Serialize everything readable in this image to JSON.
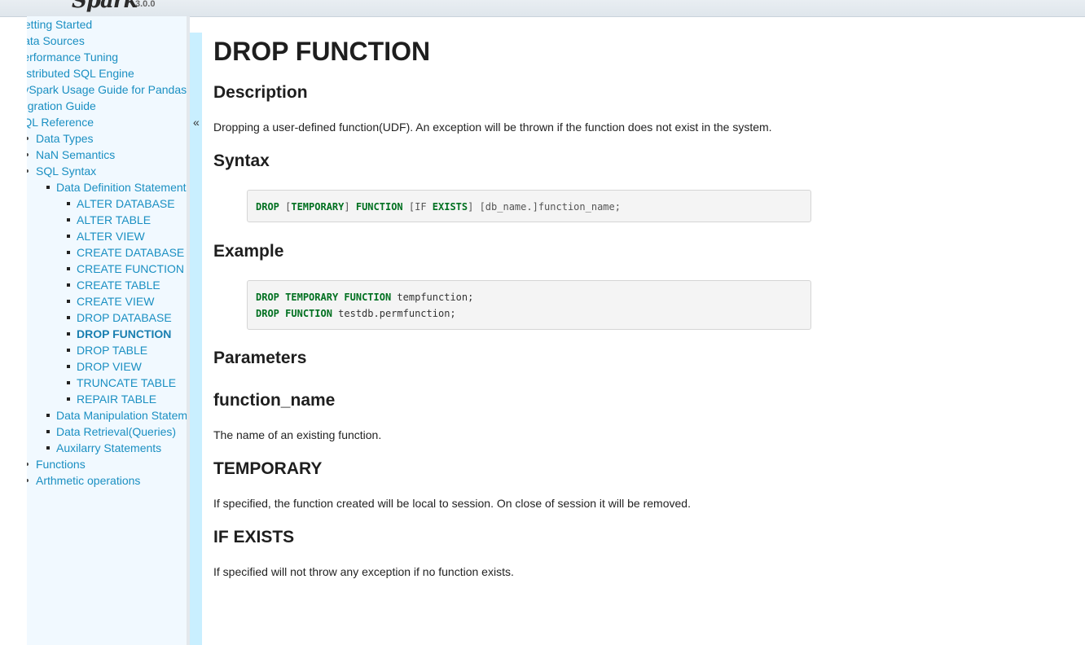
{
  "header": {
    "logo_text": "Spark",
    "version": "3.0.0"
  },
  "sidebar": {
    "collapse_glyph": "«",
    "items": [
      {
        "label": "Getting Started",
        "level": 1
      },
      {
        "label": "Data Sources",
        "level": 1
      },
      {
        "label": "Performance Tuning",
        "level": 1
      },
      {
        "label": "Distributed SQL Engine",
        "level": 1
      },
      {
        "label": "PySpark Usage Guide for Pandas",
        "level": 1
      },
      {
        "label": "Migration Guide",
        "level": 1
      },
      {
        "label": "SQL Reference",
        "level": 1
      },
      {
        "label": "Data Types",
        "level": 2
      },
      {
        "label": "NaN Semantics",
        "level": 2
      },
      {
        "label": "SQL Syntax",
        "level": 2
      },
      {
        "label": "Data Definition Statements",
        "level": 3
      },
      {
        "label": "ALTER DATABASE",
        "level": 4
      },
      {
        "label": "ALTER TABLE",
        "level": 4
      },
      {
        "label": "ALTER VIEW",
        "level": 4
      },
      {
        "label": "CREATE DATABASE",
        "level": 4
      },
      {
        "label": "CREATE FUNCTION",
        "level": 4
      },
      {
        "label": "CREATE TABLE",
        "level": 4
      },
      {
        "label": "CREATE VIEW",
        "level": 4
      },
      {
        "label": "DROP DATABASE",
        "level": 4
      },
      {
        "label": "DROP FUNCTION",
        "level": 4,
        "active": true
      },
      {
        "label": "DROP TABLE",
        "level": 4
      },
      {
        "label": "DROP VIEW",
        "level": 4
      },
      {
        "label": "TRUNCATE TABLE",
        "level": 4
      },
      {
        "label": "REPAIR TABLE",
        "level": 4
      },
      {
        "label": "Data Manipulation Statements",
        "level": 3
      },
      {
        "label": "Data Retrieval(Queries)",
        "level": 3
      },
      {
        "label": "Auxilarry Statements",
        "level": 3
      },
      {
        "label": "Functions",
        "level": 2
      },
      {
        "label": "Arthmetic operations",
        "level": 2
      }
    ]
  },
  "main": {
    "title": "DROP FUNCTION",
    "description_heading": "Description",
    "description_text": "Dropping a user-defined function(UDF). An exception will be thrown if the function does not exist in the system.",
    "syntax_heading": "Syntax",
    "syntax": {
      "kw_drop": "DROP",
      "open1": " [",
      "kw_temporary": "TEMPORARY",
      "close1": "] ",
      "kw_function": "FUNCTION",
      "open2": " [IF ",
      "kw_exists": "EXISTS",
      "rest": "] [db_name.]function_name;"
    },
    "example_heading": "Example",
    "example": {
      "line1_kw1": "DROP",
      "line1_kw2": "TEMPORARY",
      "line1_kw3": "FUNCTION",
      "line1_rest": " tempfunction;",
      "line2_kw1": "DROP",
      "line2_kw2": "FUNCTION",
      "line2_rest": " testdb.permfunction;"
    },
    "parameters_heading": "Parameters",
    "param1_heading": "function_name",
    "param1_text": "The name of an existing function.",
    "param2_heading": "TEMPORARY",
    "param2_text": "If specified, the function created will be local to session. On close of session it will be removed.",
    "param3_heading": "IF EXISTS",
    "param3_text": "If specified will not throw any exception if no function exists."
  }
}
